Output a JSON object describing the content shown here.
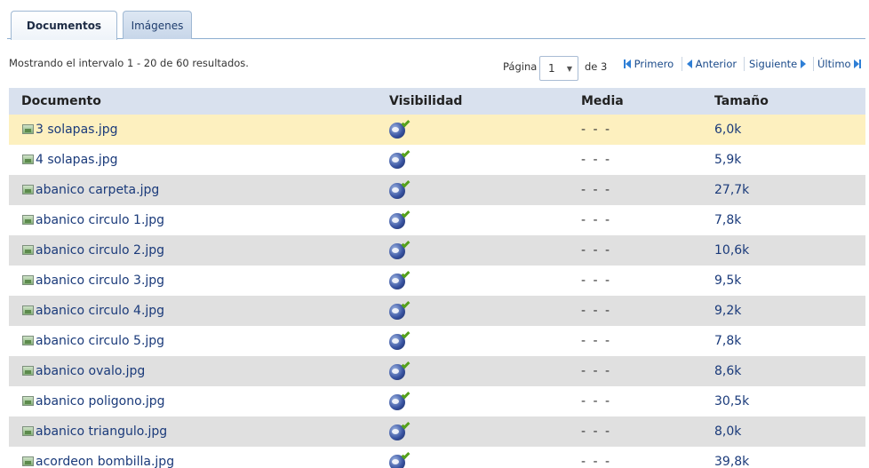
{
  "tabs": [
    {
      "label": "Documentos",
      "active": true
    },
    {
      "label": "Imágenes",
      "active": false
    }
  ],
  "summary": "Mostrando el intervalo 1 - 20 de 60 resultados.",
  "pager": {
    "page_label": "Página",
    "current_page": "1",
    "of_label": "de 3",
    "first": "Primero",
    "prev": "Anterior",
    "next": "Siguiente",
    "last": "Último"
  },
  "table": {
    "headers": [
      "Documento",
      "Visibilidad",
      "Media",
      "Tamaño"
    ],
    "rows": [
      {
        "name": "3 solapas.jpg",
        "media": "- - -",
        "size": "6,0k"
      },
      {
        "name": "4 solapas.jpg",
        "media": "- - -",
        "size": "5,9k"
      },
      {
        "name": "abanico carpeta.jpg",
        "media": "- - -",
        "size": "27,7k"
      },
      {
        "name": "abanico circulo 1.jpg",
        "media": "- - -",
        "size": "7,8k"
      },
      {
        "name": "abanico circulo 2.jpg",
        "media": "- - -",
        "size": "10,6k"
      },
      {
        "name": "abanico circulo 3.jpg",
        "media": "- - -",
        "size": "9,5k"
      },
      {
        "name": "abanico circulo 4.jpg",
        "media": "- - -",
        "size": "9,2k"
      },
      {
        "name": "abanico circulo 5.jpg",
        "media": "- - -",
        "size": "7,8k"
      },
      {
        "name": "abanico ovalo.jpg",
        "media": "- - -",
        "size": "8,6k"
      },
      {
        "name": "abanico poligono.jpg",
        "media": "- - -",
        "size": "30,5k"
      },
      {
        "name": "abanico triangulo.jpg",
        "media": "- - -",
        "size": "8,0k"
      },
      {
        "name": "acordeon bombilla.jpg",
        "media": "- - -",
        "size": "39,8k"
      }
    ]
  },
  "colors": {
    "header_bg": "#d9e1ee",
    "selected_row": "#fdf0bf",
    "alt_row": "#e0e0e0",
    "link": "#1a3a7a",
    "nav_arrow": "#2f7fd6"
  },
  "icons": {
    "file": "image-file-icon",
    "visibility": "public-globe-icon"
  }
}
